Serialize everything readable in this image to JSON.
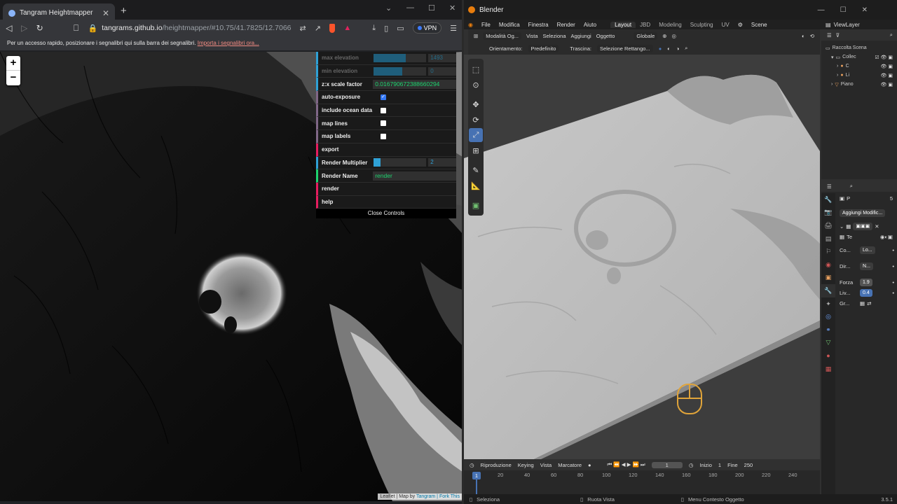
{
  "browser": {
    "tab_title": "Tangram Heightmapper",
    "url_host": "tangrams.github.io",
    "url_path": "/heightmapper/#10.75/41.7825/12.7066",
    "vpn_label": "VPN",
    "bookmark_text": "Per un accesso rapido, posizionare i segnalibri qui sulla barra dei segnalibri.",
    "bookmark_link": "Importa i segnalibri ora..."
  },
  "map": {
    "zoom_in": "+",
    "zoom_out": "−",
    "attribution_prefix": "Leaflet | Map by ",
    "attribution_link": "Tangram | Fork This"
  },
  "controls": {
    "max_elevation": {
      "label": "max elevation",
      "value": "1493",
      "fill": 0.62
    },
    "min_elevation": {
      "label": "min elevation",
      "value": "0",
      "fill": 0.55
    },
    "zscale": {
      "label": "z:x scale factor",
      "value": "0.016790672388660294"
    },
    "auto_exposure": {
      "label": "auto-exposure",
      "checked": true
    },
    "ocean": {
      "label": "include ocean data",
      "checked": false
    },
    "map_lines": {
      "label": "map lines",
      "checked": false
    },
    "map_labels": {
      "label": "map labels",
      "checked": false
    },
    "export": {
      "label": "export"
    },
    "render_multiplier": {
      "label": "Render Multiplier",
      "value": "2",
      "fill": 0.14
    },
    "render_name": {
      "label": "Render Name",
      "value": "render"
    },
    "render": {
      "label": "render"
    },
    "help": {
      "label": "help"
    },
    "close": "Close Controls"
  },
  "blender": {
    "title": "Blender",
    "menu": [
      "File",
      "Modifica",
      "Finestra",
      "Render",
      "Aiuto"
    ],
    "workspaces": [
      "Layout",
      "JBD",
      "Modeling",
      "Sculpting",
      "UV"
    ],
    "scene": "Scene",
    "viewlayer": "ViewLayer",
    "vp_header": {
      "mode": "Modalità Og...",
      "items": [
        "Vista",
        "Seleziona",
        "Aggiungi",
        "Oggetto"
      ],
      "transform": "Globale"
    },
    "vp_header2": {
      "orient_label": "Orientamento:",
      "orient_value": "Predefinito",
      "drag_label": "Trascina:",
      "drag_value": "Selezione Rettango..."
    },
    "outliner": {
      "root": "Raccolta Scena",
      "items": [
        "Collec",
        "C",
        "Li",
        "Piano"
      ]
    },
    "properties": {
      "search": "",
      "scene_hint": "P",
      "count": "5",
      "add_modifier": "Aggiungi Modific...",
      "modifier_name": "Te",
      "co_label": "Co...",
      "co_value": "Lo...",
      "dir_label": "Dir...",
      "dir_value": "N...",
      "forza_label": "Forza",
      "forza_value": "1.9",
      "liv_label": "Liv...",
      "liv_value": "0.4",
      "gr_label": "Gr..."
    },
    "timeline": {
      "items": [
        "Riproduzione",
        "Keying",
        "Vista",
        "Marcatore"
      ],
      "current_frame": "1",
      "start_label": "Inizio",
      "start": "1",
      "end_label": "Fine",
      "end": "250",
      "ticks": [
        "20",
        "40",
        "60",
        "80",
        "100",
        "120",
        "140",
        "160",
        "180",
        "200",
        "220",
        "240"
      ],
      "playhead": "1"
    },
    "status": {
      "select": "Seleziona",
      "rotate": "Ruota Vista",
      "context": "Menu Contesto Oggetto",
      "version": "3.5.1"
    }
  }
}
